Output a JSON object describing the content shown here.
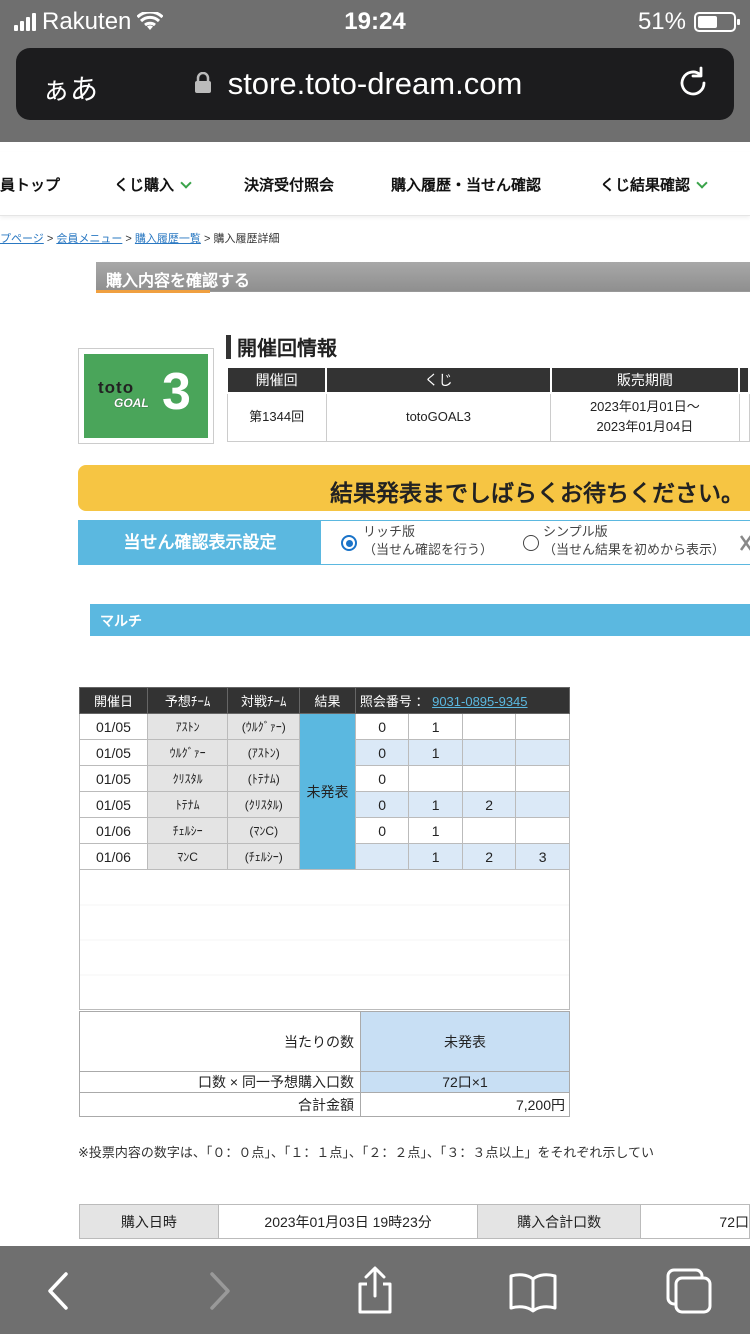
{
  "status_bar": {
    "carrier": "Rakuten",
    "time": "19:24",
    "battery": "51%"
  },
  "url_bar": {
    "text_size": "ぁあ",
    "url": "store.toto-dream.com"
  },
  "nav": {
    "items": [
      "員トップ",
      "くじ購入",
      "決済受付照会",
      "購入履歴・当せん確認",
      "くじ結果確認"
    ]
  },
  "breadcrumb": {
    "links": [
      "プページ",
      "会員メニュー",
      "購入履歴一覧"
    ],
    "current": "購入履歴詳細",
    "separator": ">"
  },
  "section_title": "購入内容を確認する",
  "logo": {
    "toto": "toto",
    "goal": "GOAL",
    "num": "3"
  },
  "event_info": {
    "heading": "開催回情報",
    "headers": [
      "開催回",
      "くじ",
      "販売期間"
    ],
    "round": "第1344回",
    "lottery": "totoGOAL3",
    "period_from": "2023年01月01日〜",
    "period_to": "2023年01月04日"
  },
  "notice": "結果発表までしばらくお待ちください。",
  "display_setting": {
    "label": "当せん確認表示設定",
    "rich": {
      "title": "リッチ版",
      "desc": "（当せん確認を行う）",
      "selected": true
    },
    "simple": {
      "title": "シンプル版",
      "desc": "（当せん結果を初めから表示）",
      "selected": false
    }
  },
  "multi_label": "マルチ",
  "picks": {
    "headers": {
      "date": "開催日",
      "team": "予想ﾁｰﾑ",
      "opponent": "対戦ﾁｰﾑ",
      "result": "結果",
      "ref_label": "照会番号 ：",
      "ref_no": "9031-0895-9345"
    },
    "result_text": "未発表",
    "rows": [
      {
        "date": "01/05",
        "team": "ｱｽﾄﾝ",
        "opp": "(ｳﾙｸﾞｧｰ)",
        "c": [
          "0",
          "1",
          "",
          ""
        ]
      },
      {
        "date": "01/05",
        "team": "ｳﾙｸﾞｧｰ",
        "opp": "(ｱｽﾄﾝ)",
        "c": [
          "0",
          "1",
          "",
          ""
        ]
      },
      {
        "date": "01/05",
        "team": "ｸﾘｽﾀﾙ",
        "opp": "(ﾄﾃﾅﾑ)",
        "c": [
          "0",
          "",
          "",
          ""
        ]
      },
      {
        "date": "01/05",
        "team": "ﾄﾃﾅﾑ",
        "opp": "(ｸﾘｽﾀﾙ)",
        "c": [
          "0",
          "1",
          "2",
          ""
        ]
      },
      {
        "date": "01/06",
        "team": "ﾁｪﾙｼｰ",
        "opp": "(ﾏﾝC)",
        "c": [
          "0",
          "1",
          "",
          ""
        ]
      },
      {
        "date": "01/06",
        "team": "ﾏﾝC",
        "opp": "(ﾁｪﾙｼｰ)",
        "c": [
          "",
          "1",
          "2",
          "3"
        ]
      }
    ]
  },
  "summary": {
    "hits_label": "当たりの数",
    "hits_value": "未発表",
    "units_label": "口数 × 同一予想購入口数",
    "units_value": "72口×1",
    "total_label": "合計金額",
    "total_value": "7,200円"
  },
  "footnote": "※投票内容の数字は、「０：０点」、「１：１点」、「２：２点」、「３：３点以上」をそれぞれ示してい",
  "purchase": {
    "date_label": "購入日時",
    "date_value": "2023年01月03日 19時23分",
    "units_label": "購入合計口数",
    "units_value": "72口"
  },
  "colors": {
    "accent_blue": "#5bb8e0",
    "notice_yellow": "#f6c543",
    "header_dark": "#333333",
    "chrome_gray": "#6f6f6f"
  }
}
